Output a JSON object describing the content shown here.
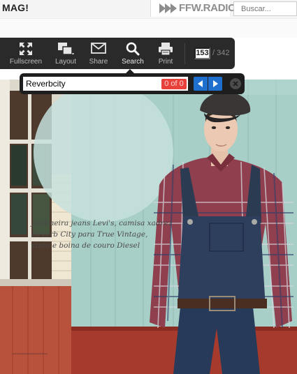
{
  "site": {
    "logo": "MAG!",
    "radio_label": "FFW.RADIO",
    "search_placeholder": "Buscar..."
  },
  "toolbar": {
    "buttons": [
      {
        "label": "Fullscreen",
        "icon": "fullscreen-icon"
      },
      {
        "label": "Layout",
        "icon": "layout-icon"
      },
      {
        "label": "Share",
        "icon": "envelope-icon"
      },
      {
        "label": "Search",
        "icon": "search-icon"
      },
      {
        "label": "Print",
        "icon": "printer-icon"
      }
    ],
    "active": "Search",
    "current_page": "153",
    "total_pages": "/ 342"
  },
  "search": {
    "query": "Reverbcity",
    "result_count": "0 of 0"
  },
  "magazine": {
    "caption": [
      "Jardineira jeans Levi's, camisa xadrez",
      "Reverb City para True Vintage,",
      "cinto e boina de couro Diesel"
    ]
  },
  "colors": {
    "toolbar_bg": "#2a2a2a",
    "nav_button": "#1f6fcf",
    "result_badge": "#e8403a",
    "wall": "#a9cfc9"
  }
}
